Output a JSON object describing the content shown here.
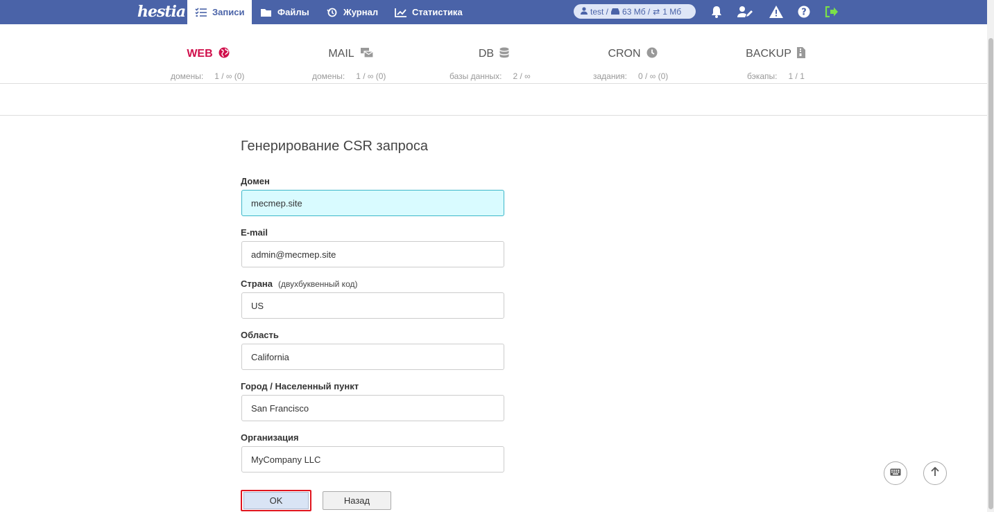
{
  "app": {
    "logo": "hestia"
  },
  "nav": {
    "items": [
      {
        "label": "Записи",
        "icon": "list-check-icon",
        "active": true
      },
      {
        "label": "Файлы",
        "icon": "folder-icon"
      },
      {
        "label": "Журнал",
        "icon": "history-icon"
      },
      {
        "label": "Статистика",
        "icon": "chart-line-icon"
      }
    ],
    "usage": {
      "user": "test /",
      "disk": "63 Мб /",
      "bandwidth": "1 Мб"
    }
  },
  "stats": [
    {
      "title": "WEB",
      "icon": "globe-icon",
      "key": "домены:",
      "value": "1 / ∞ (0)"
    },
    {
      "title": "MAIL",
      "icon": "mail-bulk-icon",
      "key": "домены:",
      "value": "1 / ∞ (0)"
    },
    {
      "title": "DB",
      "icon": "database-icon",
      "key": "базы данных:",
      "value": "2 / ∞"
    },
    {
      "title": "CRON",
      "icon": "clock-icon",
      "key": "задания:",
      "value": "0 / ∞ (0)"
    },
    {
      "title": "BACKUP",
      "icon": "file-archive-icon",
      "key": "бэкапы:",
      "value": "1 / 1"
    }
  ],
  "form": {
    "title": "Генерирование CSR запроса",
    "fields": [
      {
        "label": "Домен",
        "hint": "",
        "value": "mecmep.site"
      },
      {
        "label": "E-mail",
        "hint": "",
        "value": "admin@mecmep.site"
      },
      {
        "label": "Страна",
        "hint": "(двухбуквенный код)",
        "value": "US"
      },
      {
        "label": "Область",
        "hint": "",
        "value": "California"
      },
      {
        "label": "Город / Населенный пункт",
        "hint": "",
        "value": "San Francisco"
      },
      {
        "label": "Организация",
        "hint": "",
        "value": "MyCompany LLC"
      }
    ],
    "ok_label": "OK",
    "back_label": "Назад"
  },
  "colors": {
    "nav_bg": "#4a63a8",
    "accent": "#d0104c",
    "focus_bg": "#d9fbff",
    "highlight": "#e0141e"
  }
}
